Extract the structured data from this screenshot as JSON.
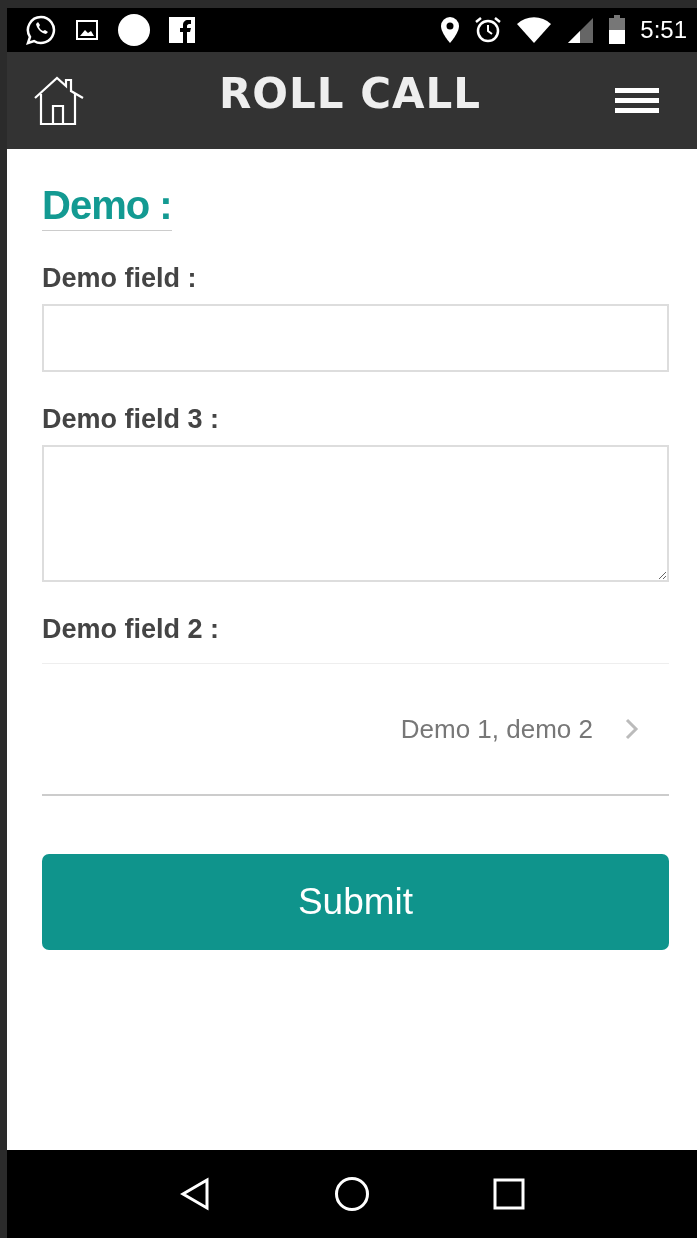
{
  "status_bar": {
    "time": "5:51"
  },
  "header": {
    "title": "ROLL CALL"
  },
  "form": {
    "title": "Demo :",
    "fields": [
      {
        "kind": "text",
        "label": "Demo field :"
      },
      {
        "kind": "textarea",
        "label": "Demo field 3 :"
      },
      {
        "kind": "select",
        "label": "Demo field 2 :",
        "value": "Demo 1, demo 2"
      }
    ],
    "submit": "Submit"
  }
}
